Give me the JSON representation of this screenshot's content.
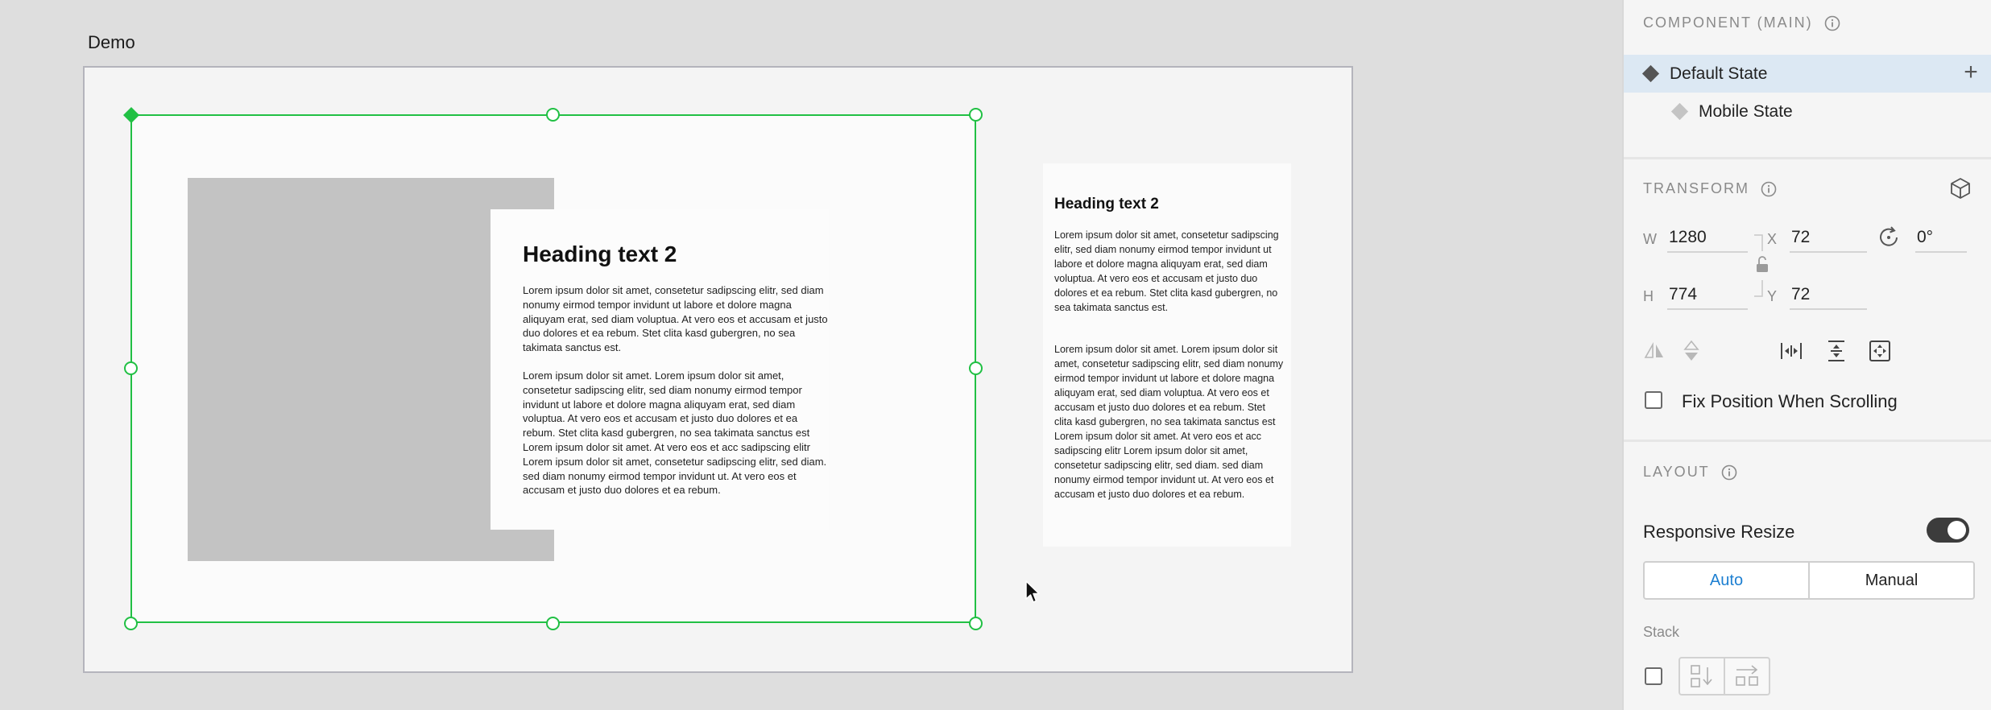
{
  "canvas": {
    "artboard_label": "Demo",
    "desktop_card": {
      "heading": "Heading text 2",
      "paragraph1": "Lorem ipsum dolor sit amet, consetetur sadipscing elitr, sed diam nonumy eirmod tempor invidunt ut labore et dolore magna aliquyam erat, sed diam voluptua. At vero eos et accusam et justo duo dolores et ea rebum. Stet clita kasd gubergren, no sea takimata sanctus est.",
      "paragraph2": "Lorem ipsum dolor sit amet. Lorem ipsum dolor sit amet, consetetur sadipscing elitr, sed diam nonumy eirmod tempor invidunt ut labore et dolore magna aliquyam erat, sed diam voluptua. At vero eos et accusam et justo duo dolores et ea rebum. Stet clita kasd gubergren, no sea takimata sanctus est Lorem ipsum dolor sit amet.  At vero eos et acc sadipscing elitr Lorem ipsum dolor sit amet, consetetur sadipscing elitr, sed diam. sed diam nonumy eirmod tempor invidunt ut. At vero eos et accusam et justo duo dolores et ea rebum."
    },
    "mobile_card": {
      "heading": "Heading text 2",
      "paragraph1": "Lorem ipsum dolor sit amet, consetetur sadipscing elitr, sed diam nonumy eirmod tempor invidunt ut labore et dolore magna aliquyam erat, sed diam voluptua. At vero eos et accusam et justo duo dolores et ea rebum. Stet clita kasd gubergren, no sea takimata sanctus est.",
      "paragraph2": "Lorem ipsum dolor sit amet. Lorem ipsum dolor sit amet, consetetur sadipscing elitr, sed diam nonumy eirmod tempor invidunt ut labore et dolore magna aliquyam erat, sed diam voluptua. At vero eos et accusam et justo duo dolores et ea rebum. Stet clita kasd gubergren, no sea takimata sanctus est Lorem ipsum dolor sit amet.  At vero eos et acc sadipscing elitr Lorem ipsum dolor sit amet, consetetur sadipscing elitr, sed diam. sed diam nonumy eirmod tempor invidunt ut. At vero eos et accusam et justo duo dolores et ea rebum."
    },
    "selection_color": "#21c044"
  },
  "panel": {
    "component": {
      "title": "COMPONENT (MAIN)",
      "states": [
        {
          "label": "Default State",
          "active": true
        },
        {
          "label": "Mobile State",
          "active": false
        }
      ]
    },
    "transform": {
      "title": "TRANSFORM",
      "w_label": "W",
      "w_value": "1280",
      "h_label": "H",
      "h_value": "774",
      "x_label": "X",
      "x_value": "72",
      "y_label": "Y",
      "y_value": "72",
      "rotation_value": "0°",
      "fix_position_label": "Fix Position When Scrolling"
    },
    "layout": {
      "title": "LAYOUT",
      "responsive_resize_label": "Responsive Resize",
      "responsive_resize_on": true,
      "modes": [
        "Auto",
        "Manual"
      ],
      "selected_mode": "Auto",
      "stack_label": "Stack"
    },
    "accent_color": "#1d7fd1"
  }
}
